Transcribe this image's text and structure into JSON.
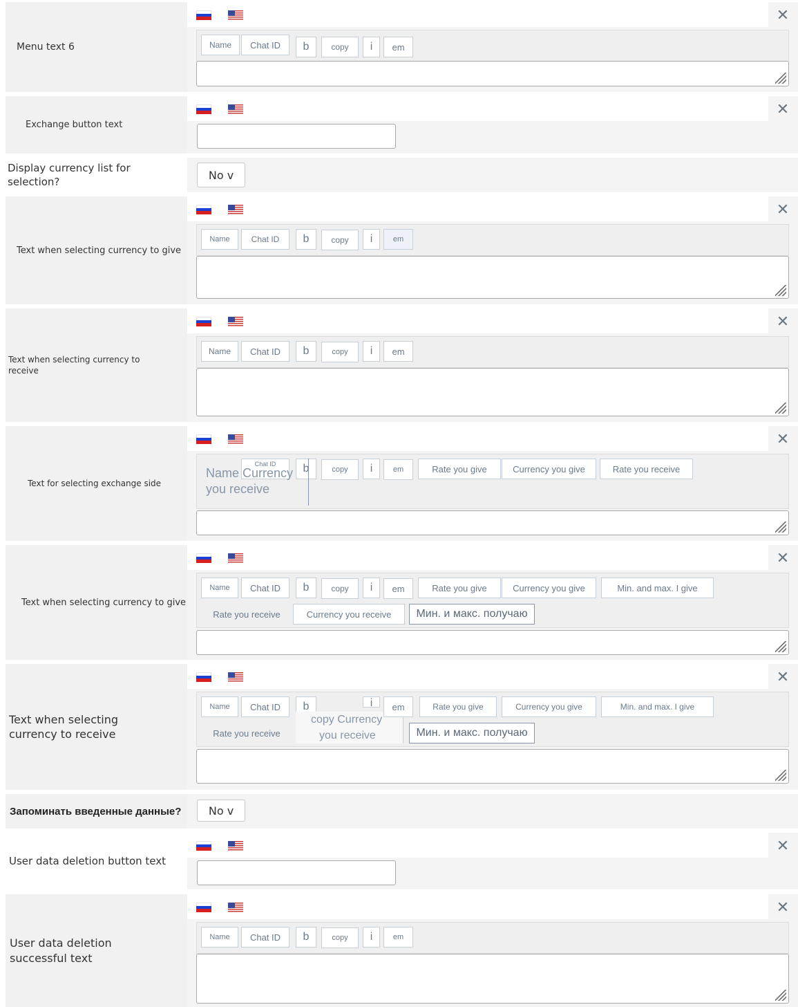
{
  "rows": [
    {
      "label": "Menu text 6"
    },
    {
      "label": "Exchange button text"
    },
    {
      "label": "Display currency list for selection?",
      "value": "No v"
    },
    {
      "label": "Text when selecting currency to give"
    },
    {
      "label": "Text when selecting currency to receive"
    },
    {
      "label": "Text for selecting exchange side"
    },
    {
      "label": "Text when selecting currency to give"
    },
    {
      "label": "Text when selecting currency to receive"
    },
    {
      "label": "Запоминать введенные данные?",
      "value": "No v"
    },
    {
      "label": "User data deletion button text"
    },
    {
      "label": "User data deletion successful text"
    }
  ],
  "toolbar": {
    "name": "Name",
    "chat_id": "Chat ID",
    "b": "b",
    "copy": "copy",
    "i": "i",
    "em": "em",
    "rate_give": "Rate you give",
    "currency_give": "Currency you give",
    "rate_receive": "Rate you receive",
    "minmax_give": "Min. and max. I give",
    "currency_receive": "Currency you receive",
    "minmax_receive": "Мин. и макс. получаю"
  },
  "overlay": {
    "name_currency": "Name Currency",
    "you_receive": "you receive",
    "copy_currency": "copy Currency"
  },
  "icons": {
    "close": "✕",
    "flag_ru": "flag-ru-icon",
    "flag_us": "flag-us-icon"
  }
}
